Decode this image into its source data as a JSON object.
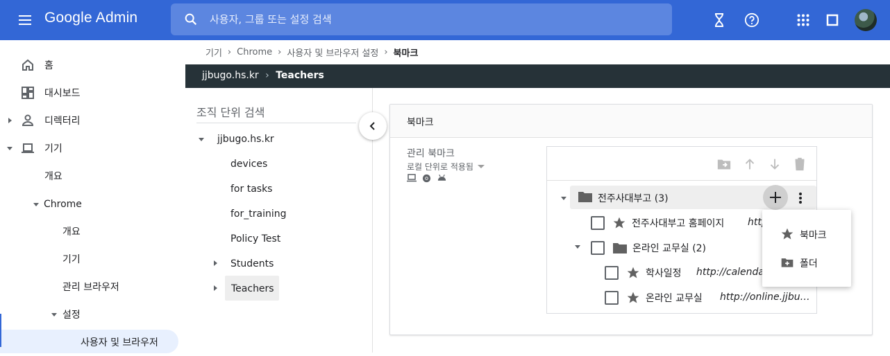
{
  "header": {
    "app_name": "Google Admin",
    "search_placeholder": "사용자, 그룹 또는 설정 검색",
    "colors": {
      "brand": "#3367d6",
      "search_bg": "#5c86e0"
    }
  },
  "sidebar": {
    "items": [
      {
        "label": "홈"
      },
      {
        "label": "대시보드"
      },
      {
        "label": "디렉터리"
      },
      {
        "label": "기기"
      },
      {
        "label": "개요"
      },
      {
        "label": "Chrome"
      },
      {
        "label": "개요"
      },
      {
        "label": "기기"
      },
      {
        "label": "관리 브라우저"
      },
      {
        "label": "설정"
      },
      {
        "label": "사용자 및 브라우저"
      }
    ]
  },
  "breadcrumb": {
    "items": [
      "기기",
      "Chrome",
      "사용자 및 브라우저 설정"
    ],
    "current": "북마크"
  },
  "org_bar": {
    "root": "jjbugo.hs.kr",
    "current": "Teachers"
  },
  "org_panel": {
    "search_label": "조직 단위 검색",
    "root": "jjbugo.hs.kr",
    "children": [
      "devices",
      "for tasks",
      "for_training",
      "Policy Test",
      "Students",
      "Teachers"
    ]
  },
  "card": {
    "title": "북마크",
    "setting_label": "관리 북마크",
    "setting_sub": "로컬 단위로 적용됨"
  },
  "tree": {
    "folder": {
      "name": "전주사대부고",
      "count": "(3)"
    },
    "items": [
      {
        "title": "전주사대부고 홈페이지",
        "url": "http"
      },
      {
        "title": "온라인 교무실",
        "count": "(2)"
      },
      {
        "title": "학사일정",
        "url": "http://calenda"
      },
      {
        "title": "온라인 교무실",
        "url": "http://online.jjbu…"
      }
    ]
  },
  "add_menu": {
    "bookmark": "북마크",
    "folder": "폴더"
  }
}
